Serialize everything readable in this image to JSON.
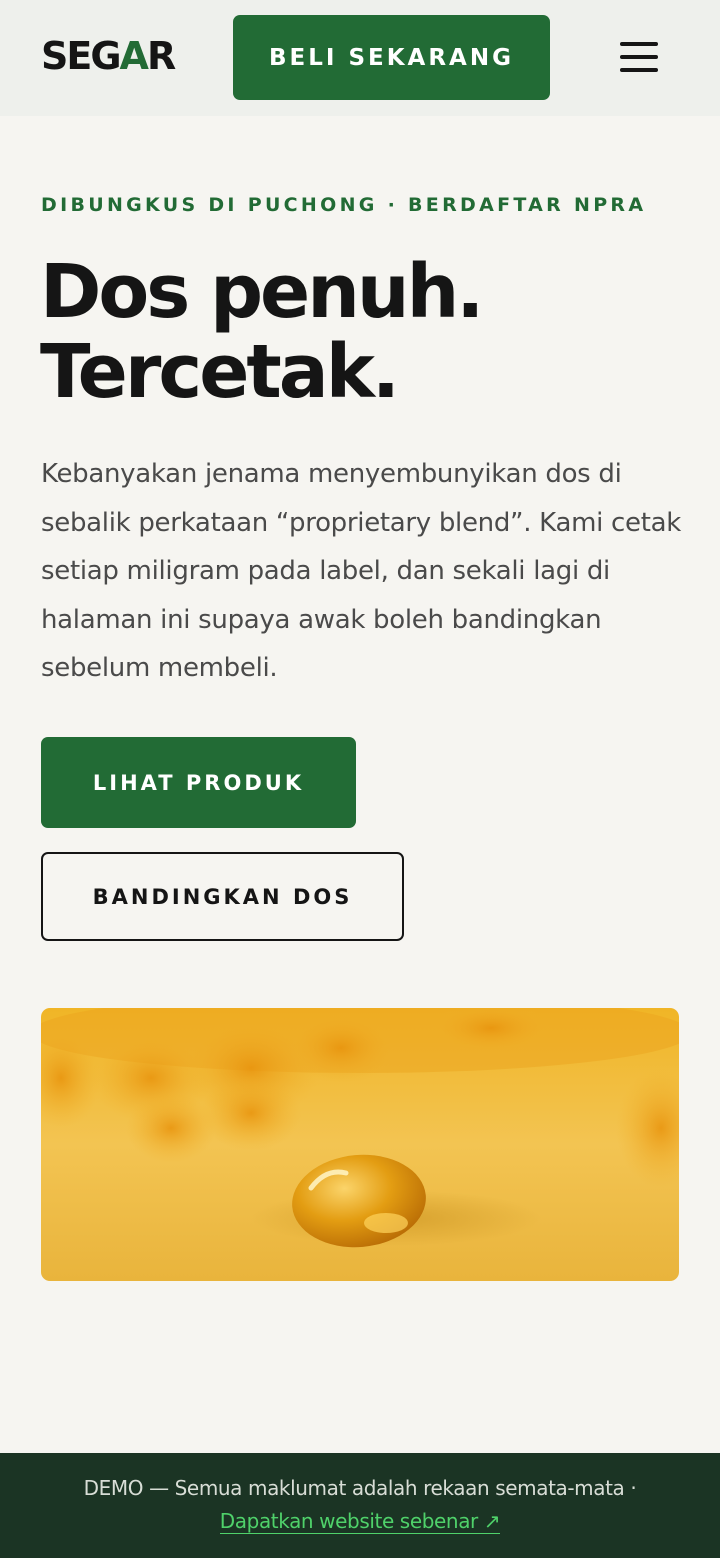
{
  "header": {
    "logo_main": "SEG",
    "logo_accent": "A",
    "logo_end": "R",
    "buy_label": "BELI SEKARANG",
    "menu_icon": "hamburger-menu-icon"
  },
  "hero": {
    "eyebrow": "DIBUNGKUS DI PUCHONG · BERDAFTAR NPRA",
    "headline_line1": "Dos penuh.",
    "headline_line2": "Tercetak.",
    "intro": "Kebanyakan jenama menyembunyikan dos di sebalik perkataan “proprietary blend”. Kami cetak setiap miligram pada label, dan sekali lagi di halaman ini supaya awak boleh bandingkan sebelum membeli.",
    "cta_primary": "LIHAT PRODUK",
    "cta_secondary": "BANDINGKAN DOS"
  },
  "footer": {
    "demo_text": "DEMO — Semua maklumat adalah rekaan semata-mata ·",
    "link_text": "Dapatkan website sebenar ↗"
  },
  "colors": {
    "brand_green": "#226b35",
    "background": "#f6f5f1",
    "footer_bg": "#1b3424",
    "link_green": "#4fd16a"
  }
}
